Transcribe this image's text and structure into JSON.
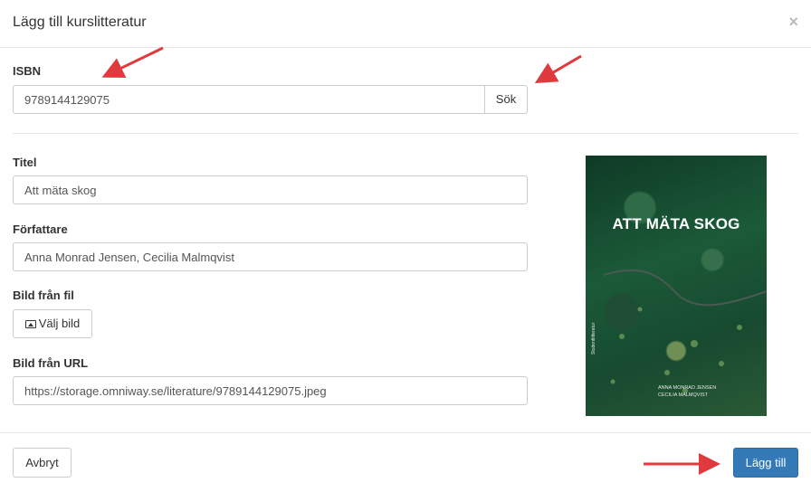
{
  "dialog": {
    "title": "Lägg till kurslitteratur",
    "close_symbol": "×"
  },
  "isbn": {
    "label": "ISBN",
    "value": "9789144129075",
    "search_label": "Sök"
  },
  "title_field": {
    "label": "Titel",
    "value": "Att mäta skog"
  },
  "author_field": {
    "label": "Författare",
    "value": "Anna Monrad Jensen, Cecilia Malmqvist"
  },
  "image_file": {
    "label": "Bild från fil",
    "button_label": "Välj bild",
    "button_icon": "image-icon"
  },
  "image_url": {
    "label": "Bild från URL",
    "value": "https://storage.omniway.se/literature/9789144129075.jpeg"
  },
  "cover": {
    "title": "ATT MÄTA SKOG",
    "author1": "ANNA MONRAD JENSEN",
    "author2": "CECILIA MALMQVIST",
    "publisher": "Studentlitteratur"
  },
  "footer": {
    "cancel_label": "Avbryt",
    "add_label": "Lägg till"
  },
  "colors": {
    "primary": "#337ab7",
    "annotation_arrow": "#e0393e"
  }
}
